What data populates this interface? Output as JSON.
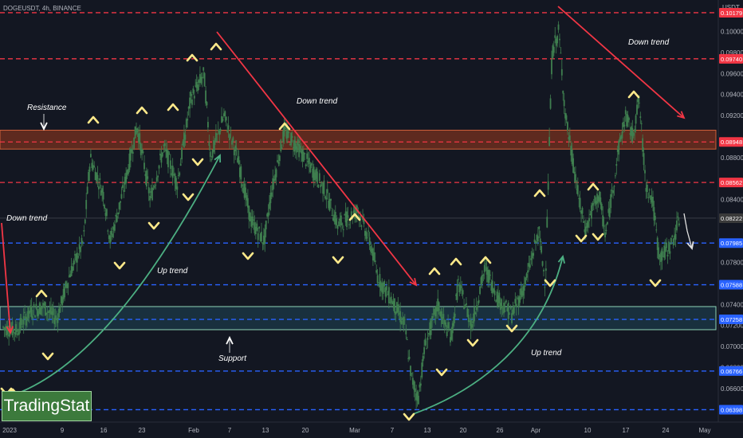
{
  "title": "DOGEUSDT, 4h, BINANCE",
  "currency": "USDT",
  "colors": {
    "background": "#131722",
    "candle": "#3f7f4f",
    "resistance_line": "#f23645",
    "support_line": "#2962ff",
    "arrow_red": "#f23645",
    "arrow_green": "#4caf82",
    "marker": "#ffe98a",
    "resistance_zone": "#9c3a1e",
    "support_zone": "#1f4a5a",
    "current_tag": "#3a3a3a"
  },
  "price_axis": {
    "labels": [
      "0.10000",
      "0.09800",
      "0.09600",
      "0.09400",
      "0.09200",
      "0.08800",
      "0.08400",
      "0.08000",
      "0.07800",
      "0.07400",
      "0.07200",
      "0.07000",
      "0.06800",
      "0.06600"
    ]
  },
  "time_axis": {
    "labels": [
      "2023",
      "9",
      "16",
      "23",
      "Feb",
      "7",
      "13",
      "20",
      "Mar",
      "7",
      "13",
      "20",
      "26",
      "Apr",
      "10",
      "17",
      "24",
      "May"
    ]
  },
  "annotations": {
    "resistance": "Resistance",
    "support": "Support",
    "down_trend": "Down trend",
    "up_trend": "Up trend"
  },
  "logo": "TradingStat",
  "chart_data": {
    "type": "candlestick",
    "symbol": "DOGEUSDT",
    "timeframe": "4h",
    "exchange": "BINANCE",
    "ylim": [
      0.0628,
      0.103
    ],
    "resistance_levels": [
      {
        "value": 0.10179,
        "label": "0.10179",
        "color": "#f23645"
      },
      {
        "value": 0.0974,
        "label": "0.09740",
        "color": "#f23645"
      },
      {
        "value": 0.08948,
        "label": "0.08948",
        "color": "#f23645"
      },
      {
        "value": 0.08562,
        "label": "0.08562",
        "color": "#f23645"
      }
    ],
    "support_levels": [
      {
        "value": 0.07985,
        "label": "0.07985",
        "color": "#2962ff"
      },
      {
        "value": 0.07588,
        "label": "0.07588",
        "color": "#2962ff"
      },
      {
        "value": 0.07258,
        "label": "0.07258",
        "color": "#2962ff"
      },
      {
        "value": 0.06766,
        "label": "0.06766",
        "color": "#2962ff"
      },
      {
        "value": 0.06398,
        "label": "0.06398",
        "color": "#2962ff"
      }
    ],
    "current_price": {
      "value": 0.08222,
      "label": "0.08222"
    },
    "resistance_zone": [
      0.0888,
      0.0906
    ],
    "support_zone": [
      0.0716,
      0.0738
    ],
    "path": [
      {
        "d": 0,
        "p": 0.0718
      },
      {
        "d": 2,
        "p": 0.0715
      },
      {
        "d": 4,
        "p": 0.0733
      },
      {
        "d": 6,
        "p": 0.0738
      },
      {
        "d": 8,
        "p": 0.0726
      },
      {
        "d": 10,
        "p": 0.077
      },
      {
        "d": 12,
        "p": 0.08
      },
      {
        "d": 13,
        "p": 0.088
      },
      {
        "d": 15,
        "p": 0.0845
      },
      {
        "d": 16,
        "p": 0.08
      },
      {
        "d": 18,
        "p": 0.085
      },
      {
        "d": 20,
        "p": 0.091
      },
      {
        "d": 22,
        "p": 0.084
      },
      {
        "d": 24,
        "p": 0.089
      },
      {
        "d": 26,
        "p": 0.0855
      },
      {
        "d": 28,
        "p": 0.0935
      },
      {
        "d": 30,
        "p": 0.096
      },
      {
        "d": 31,
        "p": 0.088
      },
      {
        "d": 33,
        "p": 0.092
      },
      {
        "d": 35,
        "p": 0.088
      },
      {
        "d": 37,
        "p": 0.082
      },
      {
        "d": 39,
        "p": 0.08
      },
      {
        "d": 40,
        "p": 0.0845
      },
      {
        "d": 42,
        "p": 0.0905
      },
      {
        "d": 44,
        "p": 0.089
      },
      {
        "d": 46,
        "p": 0.087
      },
      {
        "d": 48,
        "p": 0.085
      },
      {
        "d": 50,
        "p": 0.0815
      },
      {
        "d": 52,
        "p": 0.0825
      },
      {
        "d": 53,
        "p": 0.083
      },
      {
        "d": 55,
        "p": 0.0795
      },
      {
        "d": 56,
        "p": 0.0765
      },
      {
        "d": 58,
        "p": 0.0745
      },
      {
        "d": 60,
        "p": 0.072
      },
      {
        "d": 61,
        "p": 0.067
      },
      {
        "d": 62,
        "p": 0.065
      },
      {
        "d": 63,
        "p": 0.07
      },
      {
        "d": 65,
        "p": 0.074
      },
      {
        "d": 66,
        "p": 0.072
      },
      {
        "d": 67,
        "p": 0.071
      },
      {
        "d": 68,
        "p": 0.076
      },
      {
        "d": 70,
        "p": 0.072
      },
      {
        "d": 72,
        "p": 0.0775
      },
      {
        "d": 74,
        "p": 0.0745
      },
      {
        "d": 76,
        "p": 0.073
      },
      {
        "d": 78,
        "p": 0.076
      },
      {
        "d": 80,
        "p": 0.081
      },
      {
        "d": 81,
        "p": 0.076
      },
      {
        "d": 82,
        "p": 0.098
      },
      {
        "d": 83,
        "p": 0.1
      },
      {
        "d": 84,
        "p": 0.092
      },
      {
        "d": 85,
        "p": 0.088
      },
      {
        "d": 86,
        "p": 0.084
      },
      {
        "d": 87,
        "p": 0.081
      },
      {
        "d": 88,
        "p": 0.083
      },
      {
        "d": 89,
        "p": 0.0845
      },
      {
        "d": 90,
        "p": 0.0805
      },
      {
        "d": 92,
        "p": 0.089
      },
      {
        "d": 93,
        "p": 0.092
      },
      {
        "d": 94,
        "p": 0.09
      },
      {
        "d": 95,
        "p": 0.0935
      },
      {
        "d": 96,
        "p": 0.0855
      },
      {
        "d": 97,
        "p": 0.084
      },
      {
        "d": 98,
        "p": 0.0785
      },
      {
        "d": 99,
        "p": 0.079
      },
      {
        "d": 100,
        "p": 0.08
      },
      {
        "d": 101,
        "p": 0.082
      }
    ]
  }
}
